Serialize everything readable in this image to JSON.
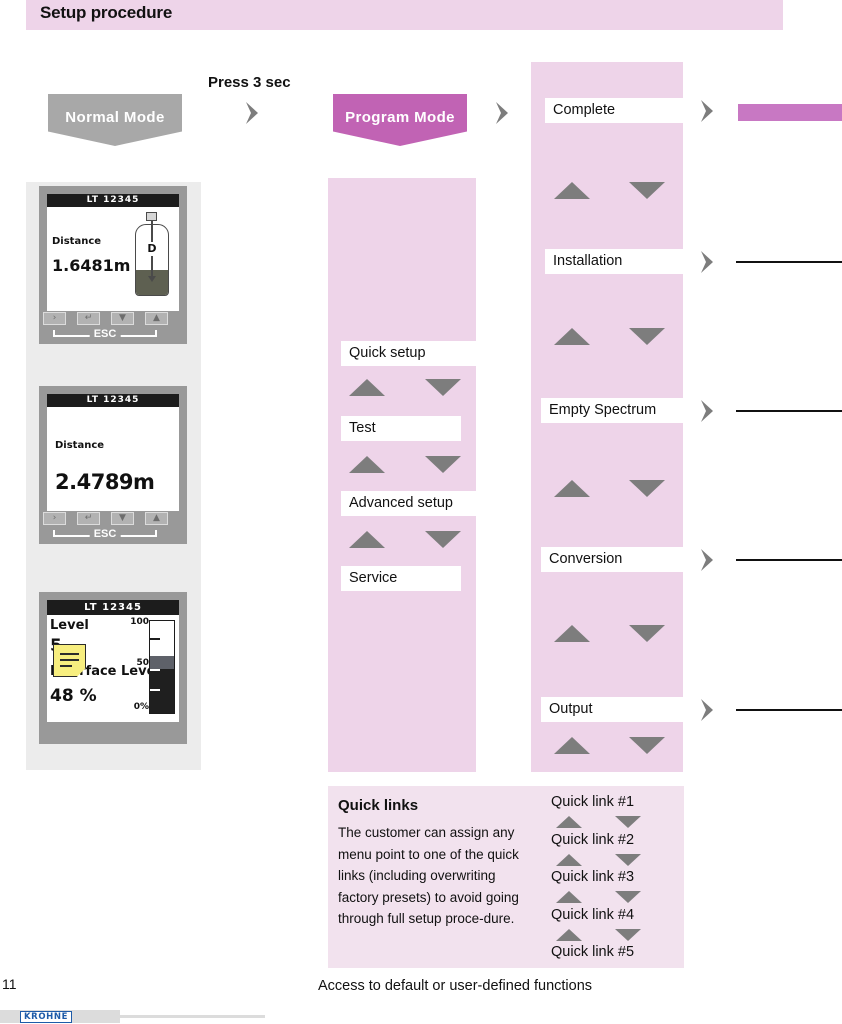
{
  "header": {
    "title": "Setup procedure"
  },
  "flow": {
    "normal_mode": "Normal Mode",
    "program_mode": "Program Mode",
    "press_label": "Press 3 sec"
  },
  "devices": [
    {
      "title": "LT 12345",
      "label": "Distance",
      "value": "1.6481m",
      "graphic": "tank-with-distance-arrow",
      "arrow_label": "D",
      "buttons": [
        "›",
        "↵",
        "▼",
        "▲"
      ],
      "esc_label": "ESC"
    },
    {
      "title": "LT 12345",
      "label": "Distance",
      "value": "2.4789m",
      "buttons": [
        "›",
        "↵",
        "▼",
        "▲"
      ],
      "esc_label": "ESC"
    },
    {
      "title": "LT 12345",
      "label": "Level",
      "value": "5",
      "label2": "Interface Level",
      "value2": "48 %",
      "gauge_labels": [
        "100",
        "50",
        "0%"
      ],
      "note_icon": "sticky-note-icon"
    }
  ],
  "program_menu": {
    "items": [
      "Quick setup",
      "Test",
      "Advanced setup",
      "Service"
    ]
  },
  "submenu": {
    "items": [
      "Complete",
      "Installation",
      "Empty Spectrum",
      "Conversion",
      "Output"
    ]
  },
  "quick_links": {
    "title": "Quick links",
    "body": "The customer can assign any menu point to one of the quick links (including overwriting factory presets) to avoid going through full setup proce-dure.",
    "items": [
      "Quick link #1",
      "Quick link #2",
      "Quick link #3",
      "Quick link #4",
      "Quick link #5"
    ]
  },
  "caption": "Access to default or user-defined functions",
  "footer": {
    "page_number": "11",
    "logo": "KROHNE"
  },
  "colors": {
    "header_pink": "#eed4e9",
    "panel_pink": "#eed4e9",
    "quicklinks_pink": "#f2e2ee",
    "program_magenta": "#c163b4",
    "rail_magenta": "#c878c3",
    "normal_gray": "#a8a8a8",
    "chevron_gray": "#7d7d7d",
    "logo_blue": "#1e5ba8"
  }
}
